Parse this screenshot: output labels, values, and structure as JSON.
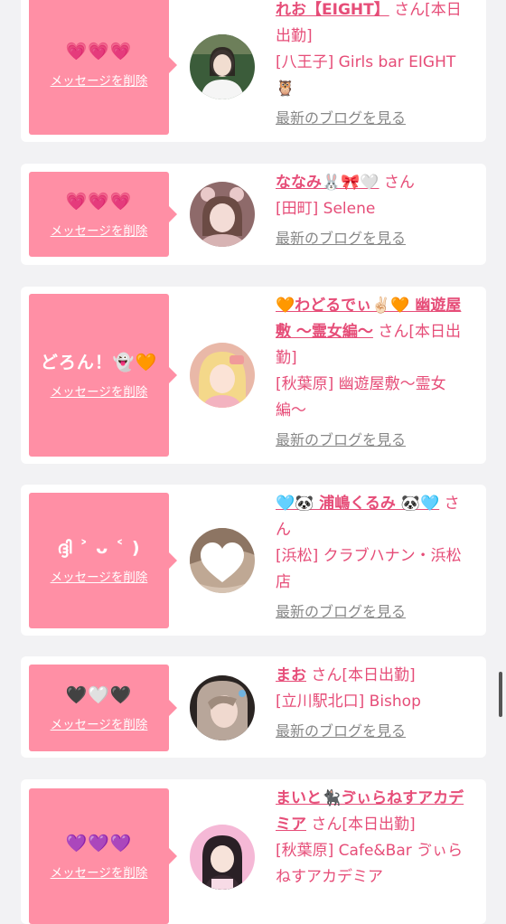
{
  "delete_label": "メッセージを削除",
  "blog_label": "最新のブログを見る",
  "san": "さん",
  "cards": [
    {
      "message": "💗💗💗",
      "name": "れお【EIGHT】",
      "san_suffix": "さん[本日出勤]",
      "shop": "[八王子] Girls bar EIGHT 🦉",
      "avatar_colors": [
        "#3b5c3a",
        "#f2f2f2",
        "#6d7f5a"
      ]
    },
    {
      "message": "💗💗💗",
      "name": "ななみ🐰🎀🤍",
      "san_suffix": "さん",
      "shop": "[田町] Selene",
      "avatar_colors": [
        "#e9c9c9",
        "#c98f8f",
        "#8e6a6a"
      ]
    },
    {
      "message": "どろん！👻🧡",
      "name": "🧡わどるでぃ✌🏻🧡 幽遊屋敷 〜霊女編〜",
      "san_suffix": "さん[本日出勤]",
      "shop": "[秋葉原] 幽遊屋敷〜霊女編〜",
      "avatar_colors": [
        "#f6d6b8",
        "#f0a7a7",
        "#d98a6a"
      ]
    },
    {
      "message": "ദ്ദി ˃ ᴗ ˂ )",
      "name": "🩵🐼 浦嶋くるみ 🐼🩵",
      "san_suffix": "さん",
      "shop": "[浜松] クラブハナン・浜松店",
      "avatar_colors": [
        "#d9c8b8",
        "#a88f7a",
        "#ffffff"
      ]
    },
    {
      "message": "🖤🤍🖤",
      "name": "まお",
      "san_suffix": "さん[本日出勤]",
      "shop": "[立川駅北口] Bishop",
      "avatar_colors": [
        "#5a4a45",
        "#c9b8ae",
        "#2a2422"
      ]
    },
    {
      "message": "💜💜💜",
      "name": "まいと🐈‍⬛ゔぃらねすアカデミア",
      "san_suffix": "さん[本日出勤]",
      "shop": "[秋葉原] Cafe&Bar ゔぃらねすアカデミア",
      "avatar_colors": [
        "#f5b8d6",
        "#2a2026",
        "#f7dbe6"
      ]
    }
  ]
}
